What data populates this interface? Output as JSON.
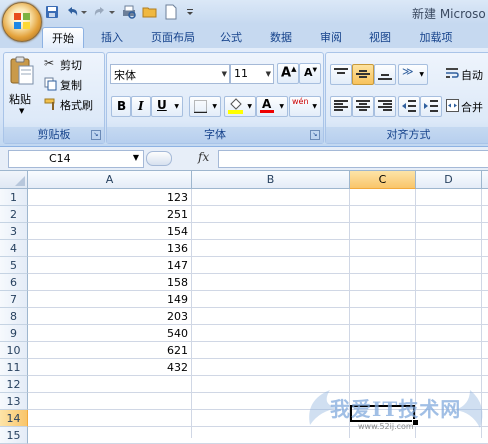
{
  "window": {
    "title": "新建 Microso"
  },
  "tabs": [
    {
      "label": "开始",
      "active": true
    },
    {
      "label": "插入"
    },
    {
      "label": "页面布局"
    },
    {
      "label": "公式"
    },
    {
      "label": "数据"
    },
    {
      "label": "审阅"
    },
    {
      "label": "视图"
    },
    {
      "label": "加载项"
    }
  ],
  "clipboard": {
    "paste": "粘贴",
    "cut": "剪切",
    "copy": "复制",
    "format_painter": "格式刷",
    "group_label": "剪贴板"
  },
  "font": {
    "name": "宋体",
    "size": "11",
    "group_label": "字体",
    "bold": "B",
    "italic": "I",
    "underline": "U",
    "font_color_glyph": "A",
    "phonetic": "wén"
  },
  "alignment": {
    "wrap": "自动",
    "merge": "合并",
    "group_label": "对齐方式"
  },
  "formula_bar": {
    "name_box": "C14",
    "fx": "fx",
    "content": ""
  },
  "columns": [
    "A",
    "B",
    "C",
    "D"
  ],
  "selected_column": "C",
  "rows": [
    "1",
    "2",
    "3",
    "4",
    "5",
    "6",
    "7",
    "8",
    "9",
    "10",
    "11",
    "12",
    "13",
    "14",
    "15"
  ],
  "selected_row": "14",
  "cells_A": [
    "123",
    "251",
    "154",
    "136",
    "147",
    "158",
    "149",
    "203",
    "540",
    "621",
    "432"
  ],
  "watermark": {
    "text": "我爱IT技术网",
    "sub": "www.52ij.com"
  },
  "colors": {
    "accent": "#15428b",
    "selection": "#f9c56a"
  }
}
